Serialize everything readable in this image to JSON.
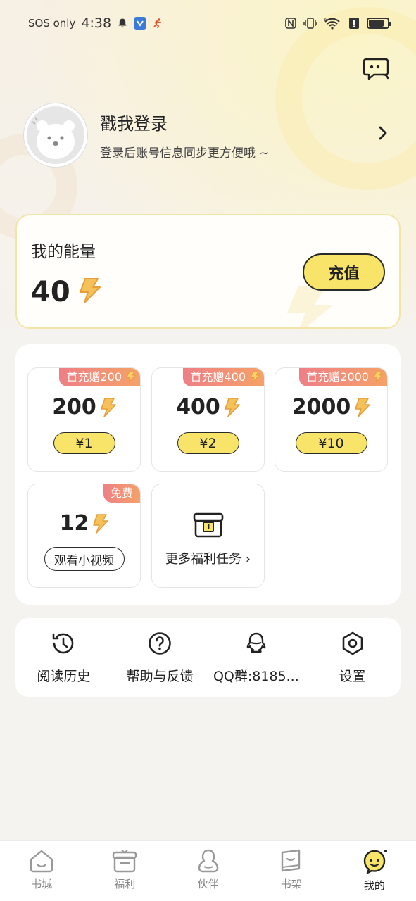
{
  "status_bar": {
    "carrier": "SOS only",
    "time": "4:38",
    "nfc": "N",
    "net_label": "6"
  },
  "profile": {
    "title": "戳我登录",
    "subtitle": "登录后账号信息同步更方便哦 ~"
  },
  "energy": {
    "label": "我的能量",
    "value": "40",
    "recharge_label": "充值"
  },
  "packages": [
    {
      "badge": "首充赠200",
      "amount": "200",
      "price": "¥1"
    },
    {
      "badge": "首充赠400",
      "amount": "400",
      "price": "¥2"
    },
    {
      "badge": "首充赠2000",
      "amount": "2000",
      "price": "¥10"
    }
  ],
  "free_package": {
    "badge": "免费",
    "amount": "12",
    "action_label": "观看小视频"
  },
  "more_tasks": {
    "label": "更多福利任务 ›"
  },
  "tools": [
    {
      "label": "阅读历史",
      "icon": "history-icon"
    },
    {
      "label": "帮助与反馈",
      "icon": "help-icon"
    },
    {
      "label": "QQ群:8185...",
      "icon": "qq-icon"
    },
    {
      "label": "设置",
      "icon": "settings-icon"
    }
  ],
  "nav": [
    {
      "label": "书城",
      "icon": "home-icon",
      "active": false
    },
    {
      "label": "福利",
      "icon": "gift-icon",
      "active": false
    },
    {
      "label": "伙伴",
      "icon": "partner-icon",
      "active": false
    },
    {
      "label": "书架",
      "icon": "bookshelf-icon",
      "active": false
    },
    {
      "label": "我的",
      "icon": "me-icon",
      "active": true
    }
  ],
  "colors": {
    "accent_yellow": "#f9e46a",
    "badge_pink": "#ef7f86",
    "badge_orange": "#f5a268",
    "energy_bolt": "#f2b84b"
  }
}
